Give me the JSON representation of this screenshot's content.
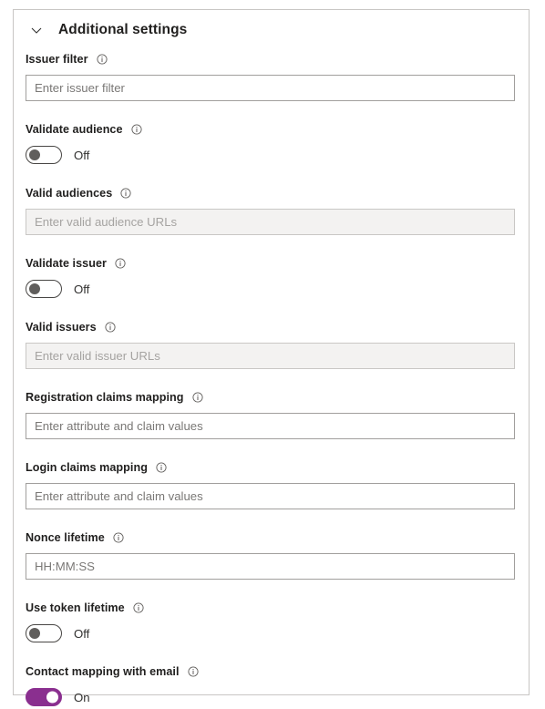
{
  "panel": {
    "title": "Additional settings",
    "collapse_icon": "chevron-down-icon",
    "info_icon": "info-icon",
    "accent_color": "#8a2f8f",
    "border_color": "#c8c6c4"
  },
  "fields": {
    "issuer_filter": {
      "label": "Issuer filter",
      "placeholder": "Enter issuer filter",
      "value": ""
    },
    "validate_audience": {
      "label": "Validate audience",
      "state_text": "Off",
      "on": false
    },
    "valid_audiences": {
      "label": "Valid audiences",
      "placeholder": "Enter valid audience URLs",
      "value": "",
      "disabled": true
    },
    "validate_issuer": {
      "label": "Validate issuer",
      "state_text": "Off",
      "on": false
    },
    "valid_issuers": {
      "label": "Valid issuers",
      "placeholder": "Enter valid issuer URLs",
      "value": "",
      "disabled": true
    },
    "registration_claims_mapping": {
      "label": "Registration claims mapping",
      "placeholder": "Enter attribute and claim values",
      "value": ""
    },
    "login_claims_mapping": {
      "label": "Login claims mapping",
      "placeholder": "Enter attribute and claim values",
      "value": ""
    },
    "nonce_lifetime": {
      "label": "Nonce lifetime",
      "placeholder": "HH:MM:SS",
      "value": ""
    },
    "use_token_lifetime": {
      "label": "Use token lifetime",
      "state_text": "Off",
      "on": false
    },
    "contact_mapping_with_email": {
      "label": "Contact mapping with email",
      "state_text": "On",
      "on": true
    }
  }
}
